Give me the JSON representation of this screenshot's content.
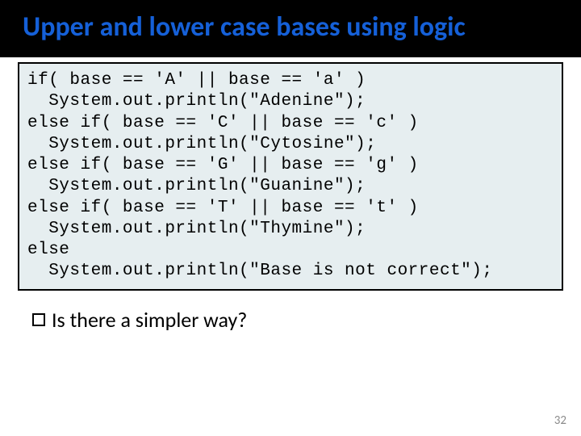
{
  "header": {
    "title": "Upper and lower case bases using logic"
  },
  "code": {
    "line1": "if( base == 'A' || base == 'a' )",
    "line2": "  System.out.println(\"Adenine\");",
    "line3": "else if( base == 'C' || base == 'c' )",
    "line4": "  System.out.println(\"Cytosine\");",
    "line5": "else if( base == 'G' || base == 'g' )",
    "line6": "  System.out.println(\"Guanine\");",
    "line7": "else if( base == 'T' || base == 't' )",
    "line8": "  System.out.println(\"Thymine\");",
    "line9": "else",
    "line10": "  System.out.println(\"Base is not correct\");"
  },
  "question": {
    "text": "Is there a simpler way?"
  },
  "page_number": "32"
}
